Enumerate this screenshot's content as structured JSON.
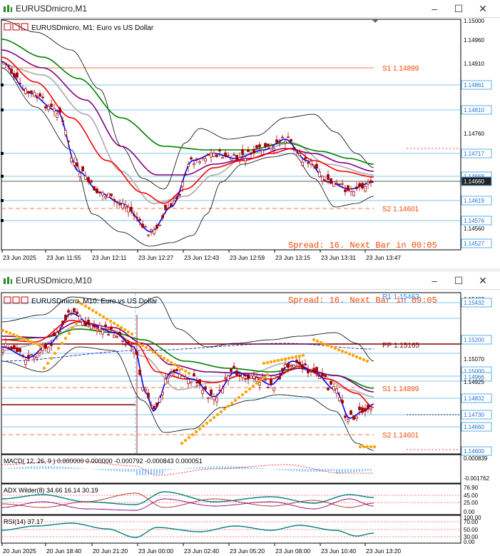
{
  "window1": {
    "title": "EURUSDmicro,M1",
    "chart_label": "EURUSDmicro, M1:  Euro vs US Dollar",
    "status": "Spread: 16. Next Bar in 00:05",
    "price_ticks": [
      "1.15000",
      "1.14960",
      "1.14910",
      "1.14861",
      "1.14810",
      "1.14760",
      "1.14717",
      "1.14668",
      "1.14660",
      "1.14619",
      "1.14576",
      "1.14560",
      "1.14527"
    ],
    "time_ticks": [
      "23 Jun 2025",
      "23 Jun 11:55",
      "23 Jun 12:11",
      "23 Jun 12:27",
      "23 Jun 12:43",
      "23 Jun 12:59",
      "23 Jun 13:15",
      "23 Jun 13:31",
      "23 Jun 13:47"
    ],
    "level_s1": "S1 1.14899",
    "level_s2": "S2 1.14601"
  },
  "window2": {
    "title": "EURUSDmicro,M10",
    "chart_label": "EURUSDmicro, M10:  Euro vs US Dollar",
    "status": "Spread: 16. Next Bar in 09:05",
    "price_ticks": [
      "1.15463",
      "1.15432",
      "1.15200",
      "1.15070",
      "1.15000",
      "1.14966",
      "1.14925",
      "1.14832",
      "1.14730",
      "1.14660",
      "1.14600"
    ],
    "time_ticks": [
      "20 Jun 2025",
      "20 Jun 18:40",
      "20 Jun 21:20",
      "23 Jun 00:00",
      "23 Jun 02:40",
      "23 Jun 05:20",
      "23 Jun 08:00",
      "23 Jun 10:40",
      "23 Jun 13:20"
    ],
    "level_r1": "R1 1.15463",
    "level_pp": "PP 1.15165",
    "level_s1": "S1 1.14899",
    "level_s2": "S2 1.14601",
    "macd_label": "MACD( 12, 26, 9 ) 0.000000 0.000000 -0.000792 -0.000843 0.000051",
    "macd_ticks": [
      "0.000839",
      "-0.001762"
    ],
    "adx_label": "ADX Wilder(8) 34.66 16.14 30.19",
    "adx_ticks": [
      "76.90",
      "45.00",
      "25.00",
      "0.00"
    ],
    "rsi_label": "RSI(14) 37.17",
    "rsi_ticks": [
      "100.00",
      "70.00",
      "50.00",
      "30.00",
      "0.00"
    ]
  },
  "colors": {
    "blue": "#0000ff",
    "red": "#ff0000",
    "green": "#008000",
    "purple": "#800080",
    "gray": "#b0b0b0",
    "orange": "#ffa500",
    "status": "#ff4500"
  }
}
